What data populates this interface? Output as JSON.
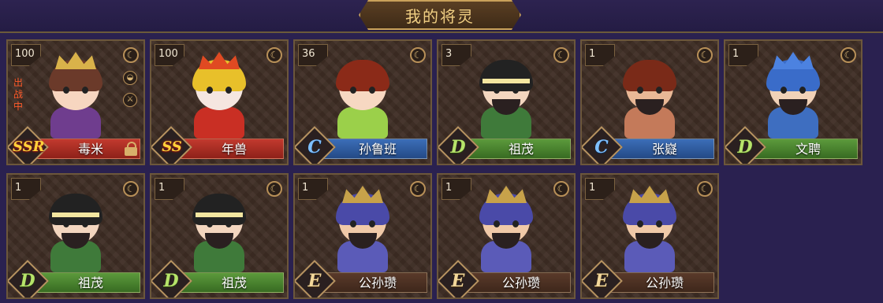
{
  "header": {
    "title": "我的将灵"
  },
  "cards": [
    {
      "level": "100",
      "name": "毒米",
      "grade": "SSR",
      "grade_class": "ssr",
      "bar": "red",
      "deployed": true,
      "deploy_text": "出战中",
      "locked": true,
      "extra_icons": true,
      "art": "goddess"
    },
    {
      "level": "100",
      "name": "年兽",
      "grade": "SS",
      "grade_class": "ss",
      "bar": "red",
      "deployed": false,
      "locked": false,
      "extra_icons": false,
      "art": "lion"
    },
    {
      "level": "36",
      "name": "孙鲁班",
      "grade": "C",
      "grade_class": "c",
      "bar": "blue",
      "deployed": false,
      "locked": false,
      "extra_icons": false,
      "art": "girl"
    },
    {
      "level": "3",
      "name": "祖茂",
      "grade": "D",
      "grade_class": "d",
      "bar": "green",
      "deployed": false,
      "locked": false,
      "extra_icons": false,
      "art": "warrior"
    },
    {
      "level": "1",
      "name": "张嶷",
      "grade": "C",
      "grade_class": "c",
      "bar": "blue",
      "deployed": false,
      "locked": false,
      "extra_icons": false,
      "art": "brawler"
    },
    {
      "level": "1",
      "name": "文聘",
      "grade": "D",
      "grade_class": "d",
      "bar": "green",
      "deployed": false,
      "locked": false,
      "extra_icons": false,
      "art": "knight"
    },
    {
      "level": "1",
      "name": "祖茂",
      "grade": "D",
      "grade_class": "d",
      "bar": "green",
      "deployed": false,
      "locked": false,
      "extra_icons": false,
      "art": "warrior"
    },
    {
      "level": "1",
      "name": "祖茂",
      "grade": "D",
      "grade_class": "d",
      "bar": "green",
      "deployed": false,
      "locked": false,
      "extra_icons": false,
      "art": "warrior"
    },
    {
      "level": "1",
      "name": "公孙瓒",
      "grade": "E",
      "grade_class": "e",
      "bar": "brown",
      "deployed": false,
      "locked": false,
      "extra_icons": false,
      "art": "jester"
    },
    {
      "level": "1",
      "name": "公孙瓒",
      "grade": "E",
      "grade_class": "e",
      "bar": "brown",
      "deployed": false,
      "locked": false,
      "extra_icons": false,
      "art": "jester"
    },
    {
      "level": "1",
      "name": "公孙瓒",
      "grade": "E",
      "grade_class": "e",
      "bar": "brown",
      "deployed": false,
      "locked": false,
      "extra_icons": false,
      "art": "jester"
    }
  ],
  "colors": {
    "accent": "#f1cf83",
    "background": "#2a2150",
    "card": "#3d2c23"
  }
}
